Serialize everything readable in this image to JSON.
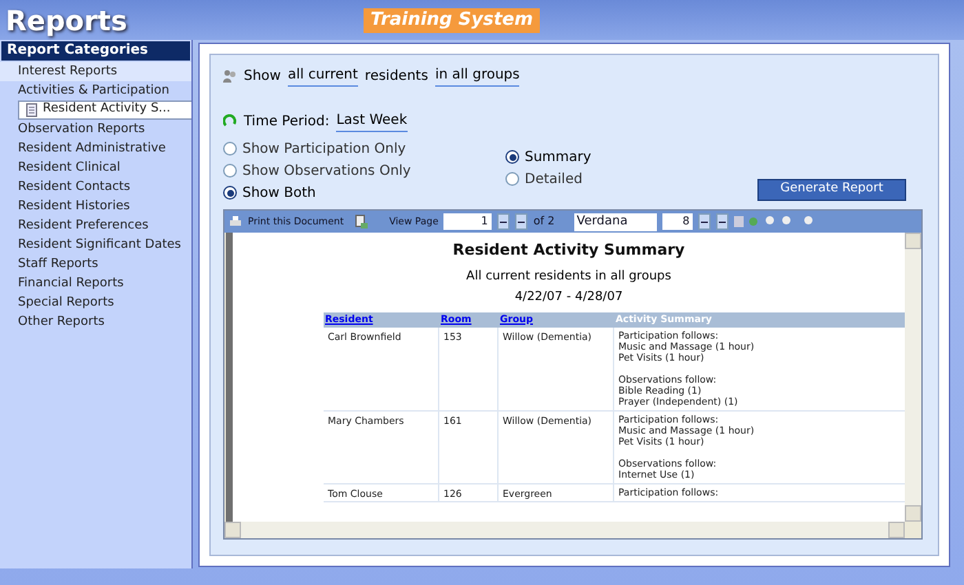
{
  "header": {
    "title": "Reports",
    "badge": "Training System"
  },
  "sidebar": {
    "heading": "Report Categories",
    "items": [
      {
        "label": "Interest Reports",
        "selected": false
      },
      {
        "label": "Activities & Participation",
        "selected": false,
        "children": [
          {
            "label": "Resident Activity S...",
            "selected": true
          }
        ]
      },
      {
        "label": "Observation Reports",
        "selected": false
      },
      {
        "label": "Resident Administrative",
        "selected": false
      },
      {
        "label": "Resident Clinical",
        "selected": false
      },
      {
        "label": "Resident Contacts",
        "selected": false
      },
      {
        "label": "Resident Histories",
        "selected": false
      },
      {
        "label": "Resident Preferences",
        "selected": false
      },
      {
        "label": "Resident Significant Dates",
        "selected": false
      },
      {
        "label": "Staff Reports",
        "selected": false
      },
      {
        "label": "Financial Reports",
        "selected": false
      },
      {
        "label": "Special Reports",
        "selected": false
      },
      {
        "label": "Other Reports",
        "selected": false
      }
    ]
  },
  "filters": {
    "show_label": "Show",
    "residents": "all current",
    "residents_suffix": "residents",
    "groups": "in all groups",
    "time_label": "Time Period:",
    "time_value": "Last Week"
  },
  "content_options": [
    {
      "label": "Show Participation Only",
      "selected": false
    },
    {
      "label": "Show Observations Only",
      "selected": false
    },
    {
      "label": "Show Both",
      "selected": true
    }
  ],
  "detail_options": [
    {
      "label": "Summary",
      "selected": true
    },
    {
      "label": "Detailed",
      "selected": false
    }
  ],
  "generate_button": "Generate Report",
  "toolbar": {
    "print": "Print this Document",
    "view_page": "View Page",
    "page": "1",
    "of": "of 2",
    "font": "Verdana",
    "size": "8"
  },
  "report": {
    "title": "Resident Activity Summary",
    "subtitle": "All current residents in all groups",
    "dates": "4/22/07 - 4/28/07",
    "columns": [
      {
        "label": "Resident",
        "link": true
      },
      {
        "label": "Room",
        "link": true
      },
      {
        "label": "Group",
        "link": true
      },
      {
        "label": "Activity Summary",
        "link": false
      }
    ],
    "rows": [
      {
        "resident": "Carl Brownfield",
        "room": "153",
        "group": "Willow (Dementia)",
        "activity": [
          [
            "Participation follows:",
            "Music and Massage (1 hour)",
            "Pet Visits (1 hour)"
          ],
          [
            "Observations follow:",
            "Bible Reading (1)",
            "Prayer (Independent) (1)"
          ]
        ]
      },
      {
        "resident": "Mary Chambers",
        "room": "161",
        "group": "Willow (Dementia)",
        "activity": [
          [
            "Participation follows:",
            "Music and Massage (1 hour)",
            "Pet Visits (1 hour)"
          ],
          [
            "Observations follow:",
            "Internet Use (1)"
          ]
        ]
      },
      {
        "resident": "Tom Clouse",
        "room": "126",
        "group": "Evergreen",
        "activity": [
          [
            "Participation follows:"
          ]
        ]
      }
    ]
  }
}
